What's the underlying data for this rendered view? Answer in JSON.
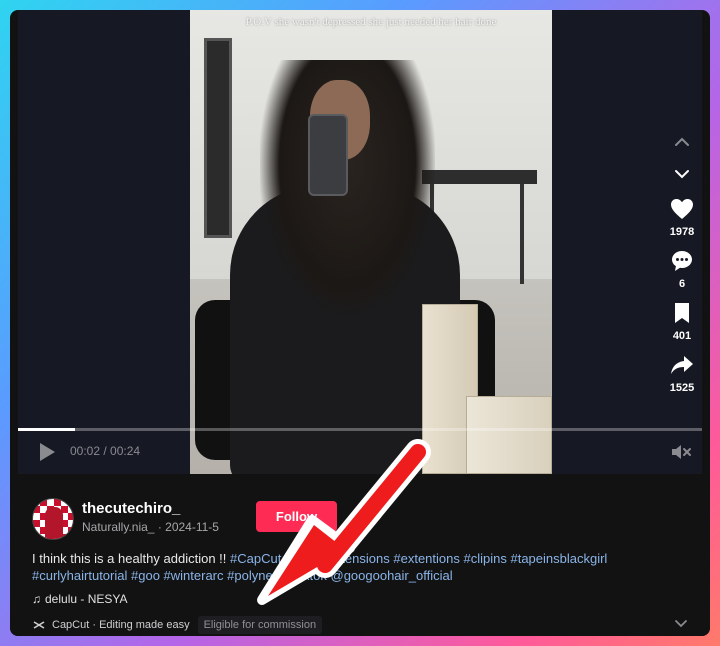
{
  "video": {
    "caption": "P.O.V she wasn't depressed she just needed her hair done",
    "progress": 0.0833,
    "time_display": "00:02 / 00:24"
  },
  "actions": {
    "likes": "1978",
    "comments": "6",
    "saves": "401",
    "shares": "1525"
  },
  "author": {
    "username": "thecutechiro_",
    "subline": "Naturally.nia_ · 2024-11-5",
    "follow_label": "Follow"
  },
  "description": {
    "text": "I think this is a healthy addiction !! ",
    "tags": [
      "#CapCut",
      "#tapeinextensions",
      "#extentions",
      "#clipins",
      "#tapeinsblackgirl",
      "#curlyhairtutorial",
      "#goo",
      "#winterarc",
      "#polynesiantiktok",
      "@googoohair_official"
    ]
  },
  "music": {
    "label": "delulu - NESYA"
  },
  "footer": {
    "capcut_text": "CapCut · Editing made easy",
    "eligible_text": "Eligible for commission"
  },
  "colors": {
    "accent": "#fe2c55",
    "tag": "#8ab4e8",
    "annotation_arrow": "#ee1c1c"
  },
  "icons": {
    "play": "play-icon",
    "mute": "mute-icon",
    "up": "chevron-up-icon",
    "down": "chevron-down-icon",
    "like": "heart-icon",
    "comment": "comment-icon",
    "save": "bookmark-icon",
    "share": "share-icon",
    "music": "music-note-icon",
    "capcut": "capcut-icon",
    "expand": "chevron-down-icon"
  }
}
